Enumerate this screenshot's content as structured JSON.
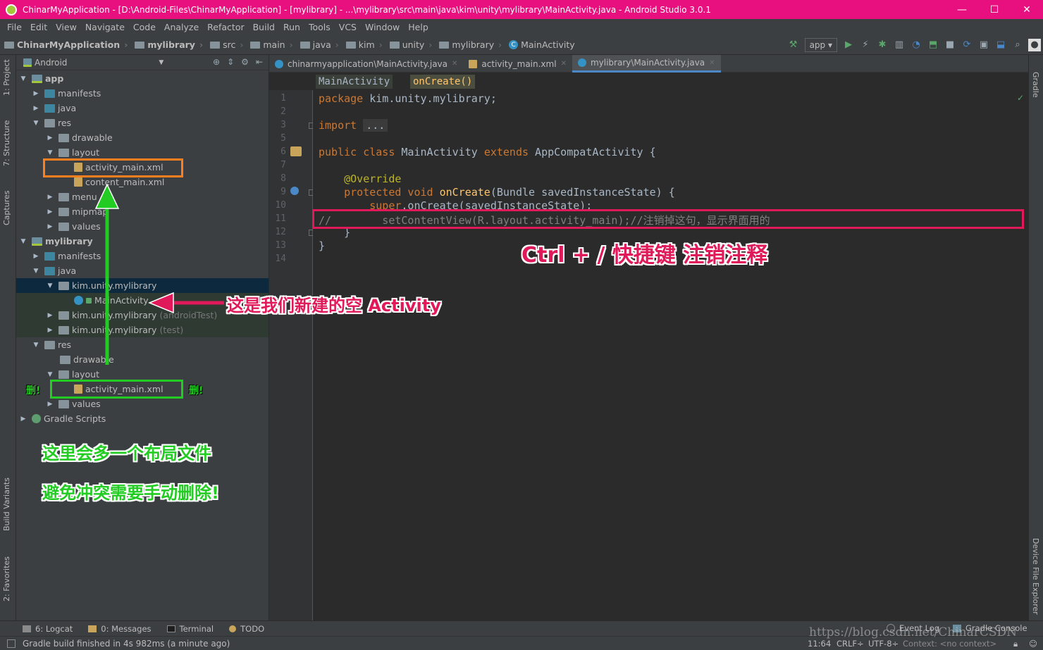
{
  "window": {
    "title": "ChinarMyApplication - [D:\\Android-Files\\ChinarMyApplication] - [mylibrary] - ...\\mylibrary\\src\\main\\java\\kim\\unity\\mylibrary\\MainActivity.java - Android Studio 3.0.1",
    "minimize": "—",
    "maximize": "☐",
    "close": "✕"
  },
  "menu": [
    "File",
    "Edit",
    "View",
    "Navigate",
    "Code",
    "Analyze",
    "Refactor",
    "Build",
    "Run",
    "Tools",
    "VCS",
    "Window",
    "Help"
  ],
  "navbar": {
    "crumbs": [
      "ChinarMyApplication",
      "mylibrary",
      "src",
      "main",
      "java",
      "kim",
      "unity",
      "mylibrary",
      "MainActivity"
    ],
    "run_config": "app ▾"
  },
  "sidebars": {
    "left": [
      "1: Project",
      "7: Structure",
      "Captures",
      "Build Variants",
      "2: Favorites"
    ],
    "right": [
      "Gradle",
      "Device File Explorer"
    ]
  },
  "project": {
    "view": "Android",
    "tree": [
      "app",
      "manifests",
      "java",
      "res",
      "drawable",
      "layout",
      "activity_main.xml",
      "content_main.xml",
      "menu",
      "mipmap",
      "values",
      "mylibrary",
      "manifests",
      "java",
      "kim.unity.mylibrary",
      "MainActivity",
      "kim.unity.mylibrary",
      "kim.unity.mylibrary",
      "res",
      "drawable",
      "layout",
      "activity_main.xml",
      "values",
      "Gradle Scripts"
    ],
    "suffix_android_test": "(androidTest)",
    "suffix_test": "(test)"
  },
  "tabs": [
    "chinarmyapplication\\MainActivity.java",
    "activity_main.xml",
    "mylibrary\\MainActivity.java"
  ],
  "editor": {
    "breadcrumb_class": "MainActivity",
    "breadcrumb_method": "onCreate()",
    "line_numbers": [
      "1",
      "2",
      "3",
      "6",
      "7",
      "8",
      "9",
      "10",
      "11",
      "12",
      "13",
      "14"
    ],
    "code": {
      "l1_kw": "package",
      "l1_rest": " kim.unity.mylibrary;",
      "l3_kw": "import",
      "l3_fold": "...",
      "l6_kw": "public class",
      "l6_name": " MainActivity ",
      "l6_kw2": "extends",
      "l6_rest": " AppCompatActivity {",
      "l8_ann": "@Override",
      "l9_kw": "protected void",
      "l9_fn": " onCreate",
      "l9_rest": "(Bundle savedInstanceState) {",
      "l10_kw": "super",
      "l10_rest": ".onCreate(savedInstanceState);",
      "l11_comment": "//        setContentView(R.layout.activity_main);//注销掉这句，显示界面用的",
      "l12": "}",
      "l13": "}"
    }
  },
  "annotations": {
    "shortcut": "Ctrl + / 快捷键 注销注释",
    "new_activity": "这是我们新建的空 Activity",
    "delete_left": "删!",
    "delete_right": "删!",
    "extra_layout": "这里会多一个布局文件",
    "manual_delete": "避免冲突需要手动删除!"
  },
  "bottom_tools": {
    "logcat": "6: Logcat",
    "messages": "0: Messages",
    "terminal": "Terminal",
    "todo": "TODO",
    "event_log": "Event Log",
    "gradle_console": "Gradle Console"
  },
  "status": {
    "message": "Gradle build finished in 4s 982ms (a minute ago)",
    "position": "11:64",
    "line_sep": "CRLF÷",
    "encoding": "UTF-8÷",
    "context": "Context: <no context>"
  },
  "watermark": "https://blog.csdn.net/ChinarCSDN",
  "colors": {
    "title_bar": "#e8107e",
    "highlight_orange": "#ff7f1e",
    "highlight_green": "#22cc22",
    "highlight_red": "#e0195a",
    "annotation_green": "#22cc22",
    "annotation_red": "#e0195a"
  }
}
